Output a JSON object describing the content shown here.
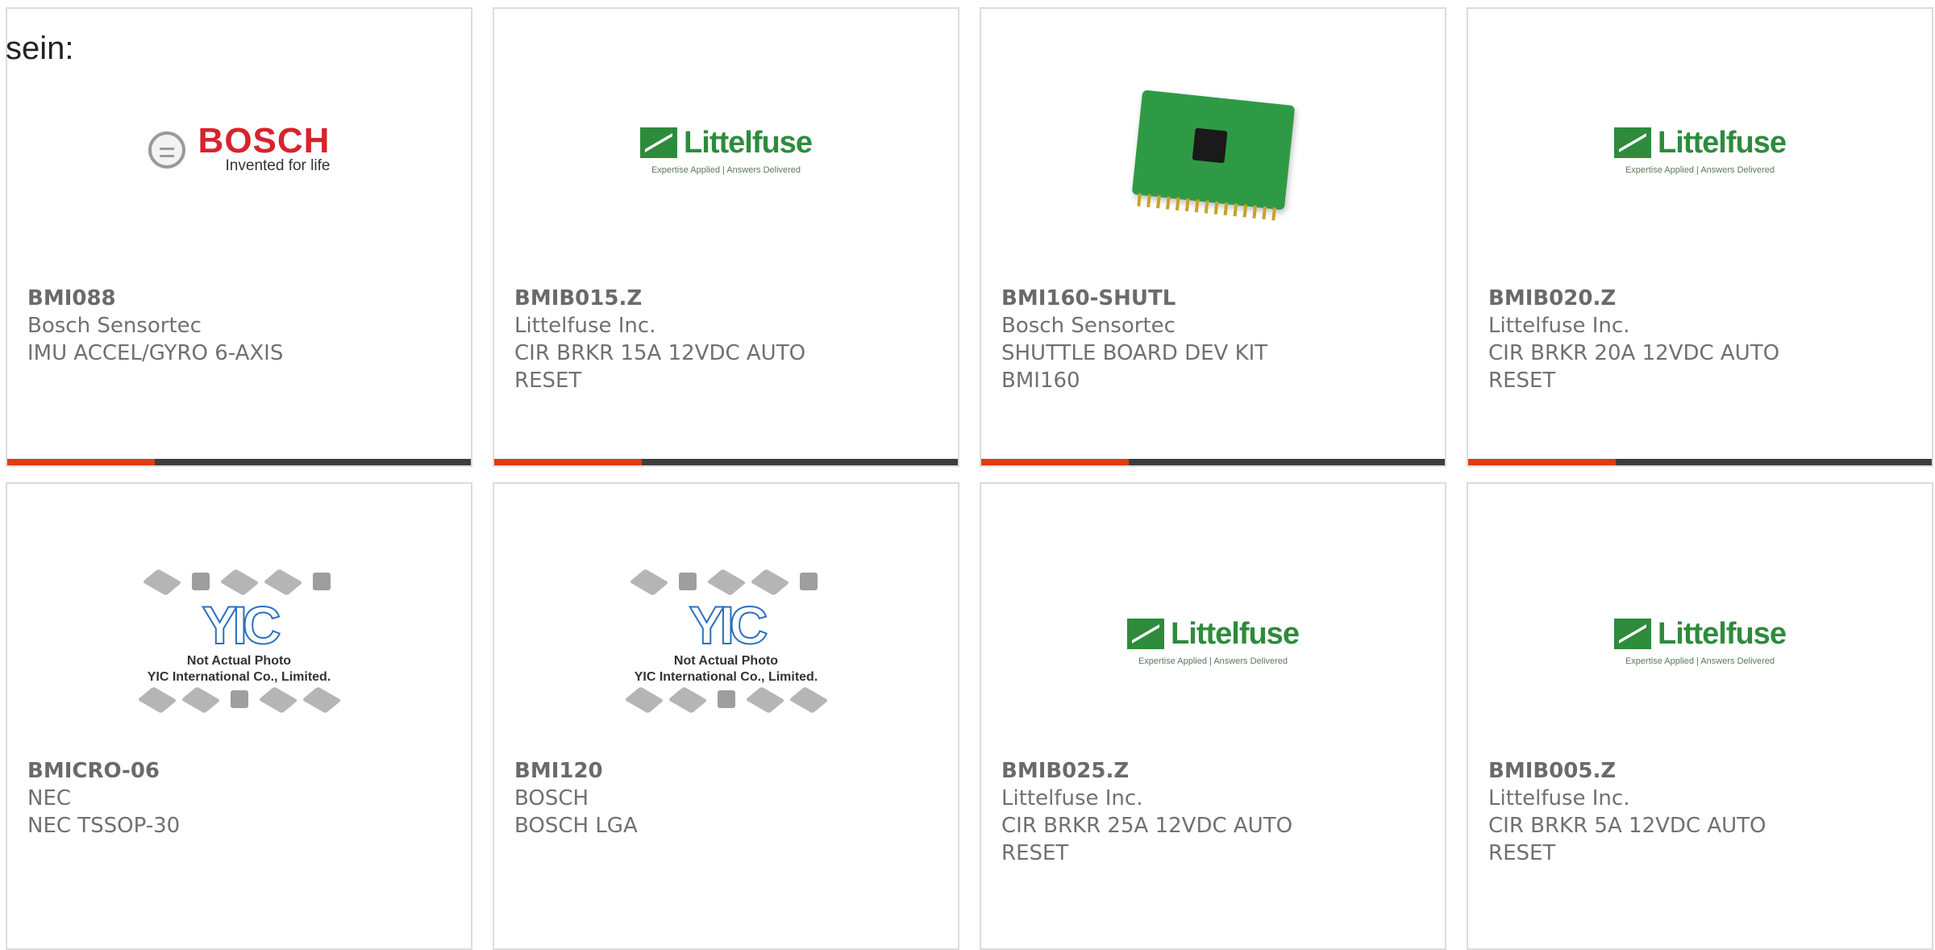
{
  "lead_text": "sein:",
  "colors": {
    "accent": "#e23a12",
    "bar": "#3d3d3d",
    "bosch_red": "#d7232d",
    "littelfuse_green": "#2e8b3c"
  },
  "products": [
    {
      "part": "BMI088",
      "manufacturer": "Bosch Sensortec",
      "description": "IMU ACCEL/GYRO 6-AXIS",
      "image": "bosch-logo",
      "logo_text": "BOSCH",
      "logo_sub": "Invented for life"
    },
    {
      "part": "BMIB015.Z",
      "manufacturer": "Littelfuse Inc.",
      "description": "CIR BRKR 15A 12VDC AUTO RESET",
      "image": "littelfuse-logo",
      "logo_text": "Littelfuse",
      "logo_sub": "Expertise Applied | Answers Delivered"
    },
    {
      "part": "BMI160-SHUTL",
      "manufacturer": "Bosch Sensortec",
      "description": "SHUTTLE BOARD DEV KIT BMI160",
      "image": "pcb-photo"
    },
    {
      "part": "BMIB020.Z",
      "manufacturer": "Littelfuse Inc.",
      "description": "CIR BRKR 20A 12VDC AUTO RESET",
      "image": "littelfuse-logo",
      "logo_text": "Littelfuse",
      "logo_sub": "Expertise Applied | Answers Delivered"
    },
    {
      "part": "BMICRO-06",
      "manufacturer": "NEC",
      "description": "NEC TSSOP-30",
      "image": "yic-placeholder",
      "logo_text": "YIC",
      "logo_sub": "Not Actual Photo",
      "logo_sub2": "YIC International Co., Limited."
    },
    {
      "part": "BMI120",
      "manufacturer": "BOSCH",
      "description": "BOSCH LGA",
      "image": "yic-placeholder",
      "logo_text": "YIC",
      "logo_sub": "Not Actual Photo",
      "logo_sub2": "YIC International Co., Limited."
    },
    {
      "part": "BMIB025.Z",
      "manufacturer": "Littelfuse Inc.",
      "description": "CIR BRKR 25A 12VDC AUTO RESET",
      "image": "littelfuse-logo",
      "logo_text": "Littelfuse",
      "logo_sub": "Expertise Applied | Answers Delivered"
    },
    {
      "part": "BMIB005.Z",
      "manufacturer": "Littelfuse Inc.",
      "description": "CIR BRKR 5A 12VDC AUTO RESET",
      "image": "littelfuse-logo",
      "logo_text": "Littelfuse",
      "logo_sub": "Expertise Applied | Answers Delivered"
    }
  ]
}
